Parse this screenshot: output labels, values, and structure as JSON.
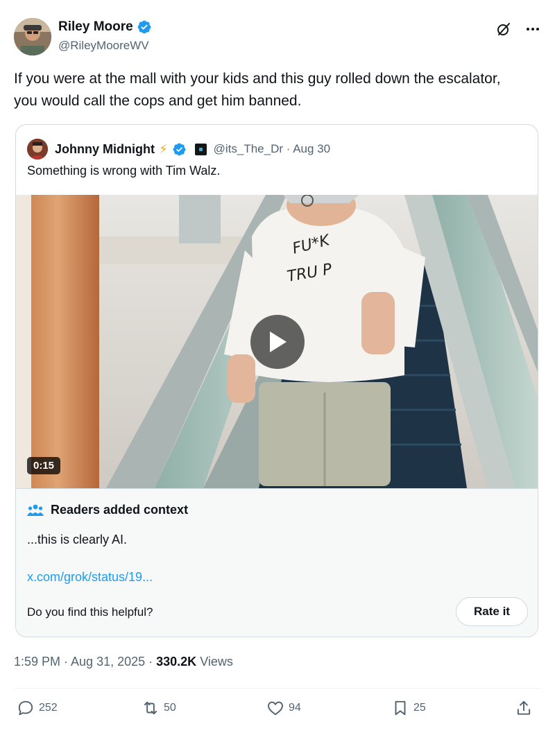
{
  "author": {
    "name": "Riley Moore",
    "handle": "@RileyMooreWV"
  },
  "tweet": {
    "text": "If you were at the mall with your kids and this guy rolled down the escalator, you would call the cops and get him banned."
  },
  "quote": {
    "name": "Johnny Midnight",
    "emoji": "⚡",
    "handle_date": "@its_The_Dr · Aug 30",
    "text": "Something is wrong with Tim Walz.",
    "video_duration": "0:15",
    "shirt_text": "FU*K TRUMP"
  },
  "context": {
    "title": "Readers added context",
    "body": "...this is clearly AI.",
    "link": "x.com/grok/status/19...",
    "question": "Do you find this helpful?",
    "rate_label": "Rate it"
  },
  "meta": {
    "time_date": "1:59 PM · Aug 31, 2025 · ",
    "views_count": "330.2K",
    "views_label": " Views"
  },
  "actions": {
    "replies": "252",
    "reposts": "50",
    "likes": "94",
    "bookmarks": "25"
  },
  "colors": {
    "verified": "#1d9bf0",
    "link": "#1d9bf0",
    "muted": "#536471"
  },
  "icons": [
    "verified-badge-icon",
    "grok-icon",
    "more-icon",
    "people-icon",
    "play-icon",
    "reply-icon",
    "repost-icon",
    "like-icon",
    "bookmark-icon",
    "share-icon"
  ]
}
